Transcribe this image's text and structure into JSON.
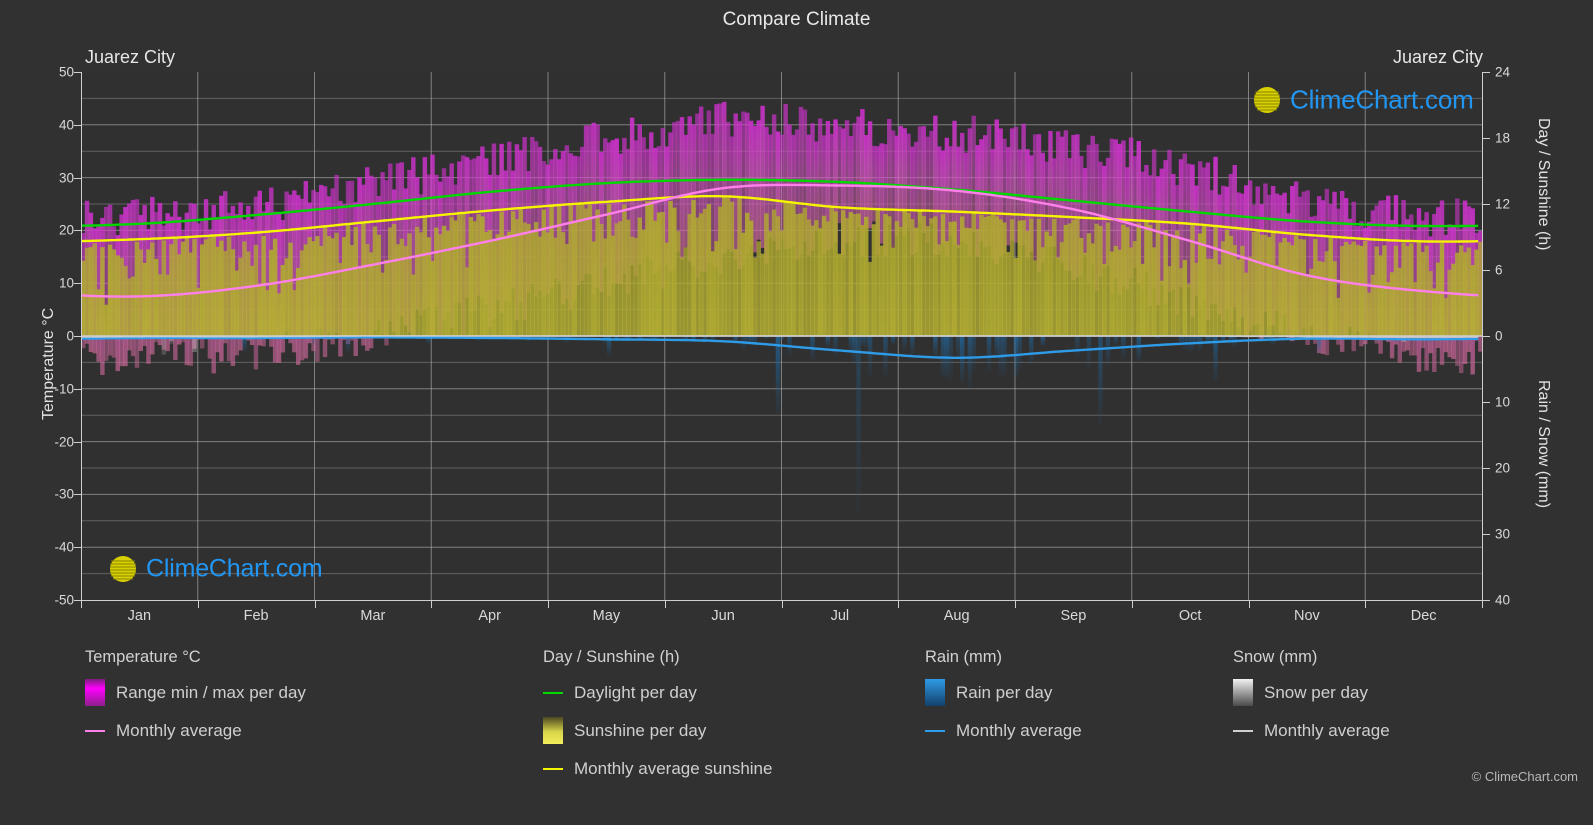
{
  "title": "Compare Climate",
  "location_left": "Juarez City",
  "location_right": "Juarez City",
  "copyright": "© ClimeChart.com",
  "logo_text": "ClimeChart.com",
  "axes": {
    "left_title": "Temperature °C",
    "right_title_top": "Day / Sunshine (h)",
    "right_title_bottom": "Rain / Snow (mm)",
    "left_ticks": [
      "50",
      "40",
      "30",
      "20",
      "10",
      "0",
      "-10",
      "-20",
      "-30",
      "-40",
      "-50"
    ],
    "right_ticks_top": [
      "24",
      "18",
      "12",
      "6",
      "0"
    ],
    "right_ticks_bottom": [
      "0",
      "10",
      "20",
      "30",
      "40"
    ],
    "x_ticks": [
      "Jan",
      "Feb",
      "Mar",
      "Apr",
      "May",
      "Jun",
      "Jul",
      "Aug",
      "Sep",
      "Oct",
      "Nov",
      "Dec"
    ]
  },
  "legend": [
    {
      "heading": "Temperature °C",
      "items": [
        {
          "label": "Range min / max per day",
          "type": "gradient",
          "color": "#ff00ff"
        },
        {
          "label": "Monthly average",
          "type": "line",
          "color": "#ff7feb"
        }
      ]
    },
    {
      "heading": "Day / Sunshine (h)",
      "items": [
        {
          "label": "Daylight per day",
          "type": "line",
          "color": "#00d800"
        },
        {
          "label": "Sunshine per day",
          "type": "gradient",
          "color": "#f2ef40"
        },
        {
          "label": "Monthly average sunshine",
          "type": "line",
          "color": "#f5f500"
        }
      ]
    },
    {
      "heading": "Rain (mm)",
      "items": [
        {
          "label": "Rain per day",
          "type": "gradient",
          "color": "#1a7fd4"
        },
        {
          "label": "Monthly average",
          "type": "line",
          "color": "#2e9ce8"
        }
      ]
    },
    {
      "heading": "Snow (mm)",
      "items": [
        {
          "label": "Snow per day",
          "type": "gradient",
          "color": "#e8e8e8"
        },
        {
          "label": "Monthly average",
          "type": "line",
          "color": "#d0d0d0"
        }
      ]
    }
  ],
  "colors": {
    "background": "#313131",
    "plot_background": "#303030",
    "grid": "#9a9a9a",
    "temp_range": "#cc22cc",
    "temp_avg": "#ff7feb",
    "daylight": "#00d800",
    "sunshine_band": "#b5b030",
    "sunshine_avg": "#f5f500",
    "rain": "#2e9ce8",
    "rain_avg": "#2e9ce8",
    "snow": "#e8e8e8"
  },
  "chart_data": {
    "type": "area",
    "title": "Compare Climate",
    "subtitle": "Juarez City",
    "xlabel": "",
    "ylabel": "Temperature °C",
    "y2label_top": "Day / Sunshine (h)",
    "y2label_bottom": "Rain / Snow (mm)",
    "ylim": [
      -50,
      50
    ],
    "y2lim_top": [
      0,
      24
    ],
    "y2lim_bottom": [
      0,
      40
    ],
    "grid": true,
    "legend_position": "below",
    "categories": [
      "Jan",
      "Feb",
      "Mar",
      "Apr",
      "May",
      "Jun",
      "Jul",
      "Aug",
      "Sep",
      "Oct",
      "Nov",
      "Dec"
    ],
    "series": [
      {
        "name": "Monthly average temperature (°C)",
        "color": "#ff7feb",
        "unit": "°C",
        "values": [
          7.5,
          9.5,
          13.5,
          18.0,
          23.0,
          28.0,
          28.5,
          27.5,
          24.0,
          18.0,
          11.5,
          8.5
        ]
      },
      {
        "name": "Daily max temperature range upper (°C)",
        "color": "#cc22cc",
        "unit": "°C",
        "values": [
          22.0,
          24.0,
          28.0,
          33.0,
          37.0,
          40.0,
          39.0,
          38.0,
          35.0,
          31.0,
          25.0,
          22.0
        ]
      },
      {
        "name": "Daily min temperature range lower (°C)",
        "color": "#cc22cc",
        "unit": "°C",
        "values": [
          -4.0,
          -3.0,
          0.0,
          5.0,
          10.0,
          15.0,
          18.0,
          17.5,
          13.0,
          6.0,
          0.0,
          -3.5
        ]
      },
      {
        "name": "Daylight per day (h)",
        "color": "#00d800",
        "unit": "h",
        "values": [
          10.2,
          11.0,
          12.0,
          13.1,
          13.9,
          14.2,
          14.0,
          13.3,
          12.3,
          11.3,
          10.4,
          10.0
        ]
      },
      {
        "name": "Monthly average sunshine (h)",
        "color": "#f5f500",
        "unit": "h",
        "values": [
          8.8,
          9.4,
          10.4,
          11.4,
          12.2,
          12.7,
          11.7,
          11.3,
          10.8,
          10.2,
          9.2,
          8.6
        ]
      },
      {
        "name": "Monthly average rain (mm)",
        "color": "#2e9ce8",
        "unit": "mm",
        "values": [
          0.3,
          0.3,
          0.2,
          0.3,
          0.5,
          0.8,
          2.2,
          3.3,
          2.2,
          1.1,
          0.4,
          0.5
        ]
      },
      {
        "name": "Monthly average snow (mm)",
        "color": "#d0d0d0",
        "unit": "mm",
        "values": [
          0.1,
          0.1,
          0.0,
          0.0,
          0.0,
          0.0,
          0.0,
          0.0,
          0.0,
          0.0,
          0.1,
          0.2
        ]
      }
    ]
  }
}
